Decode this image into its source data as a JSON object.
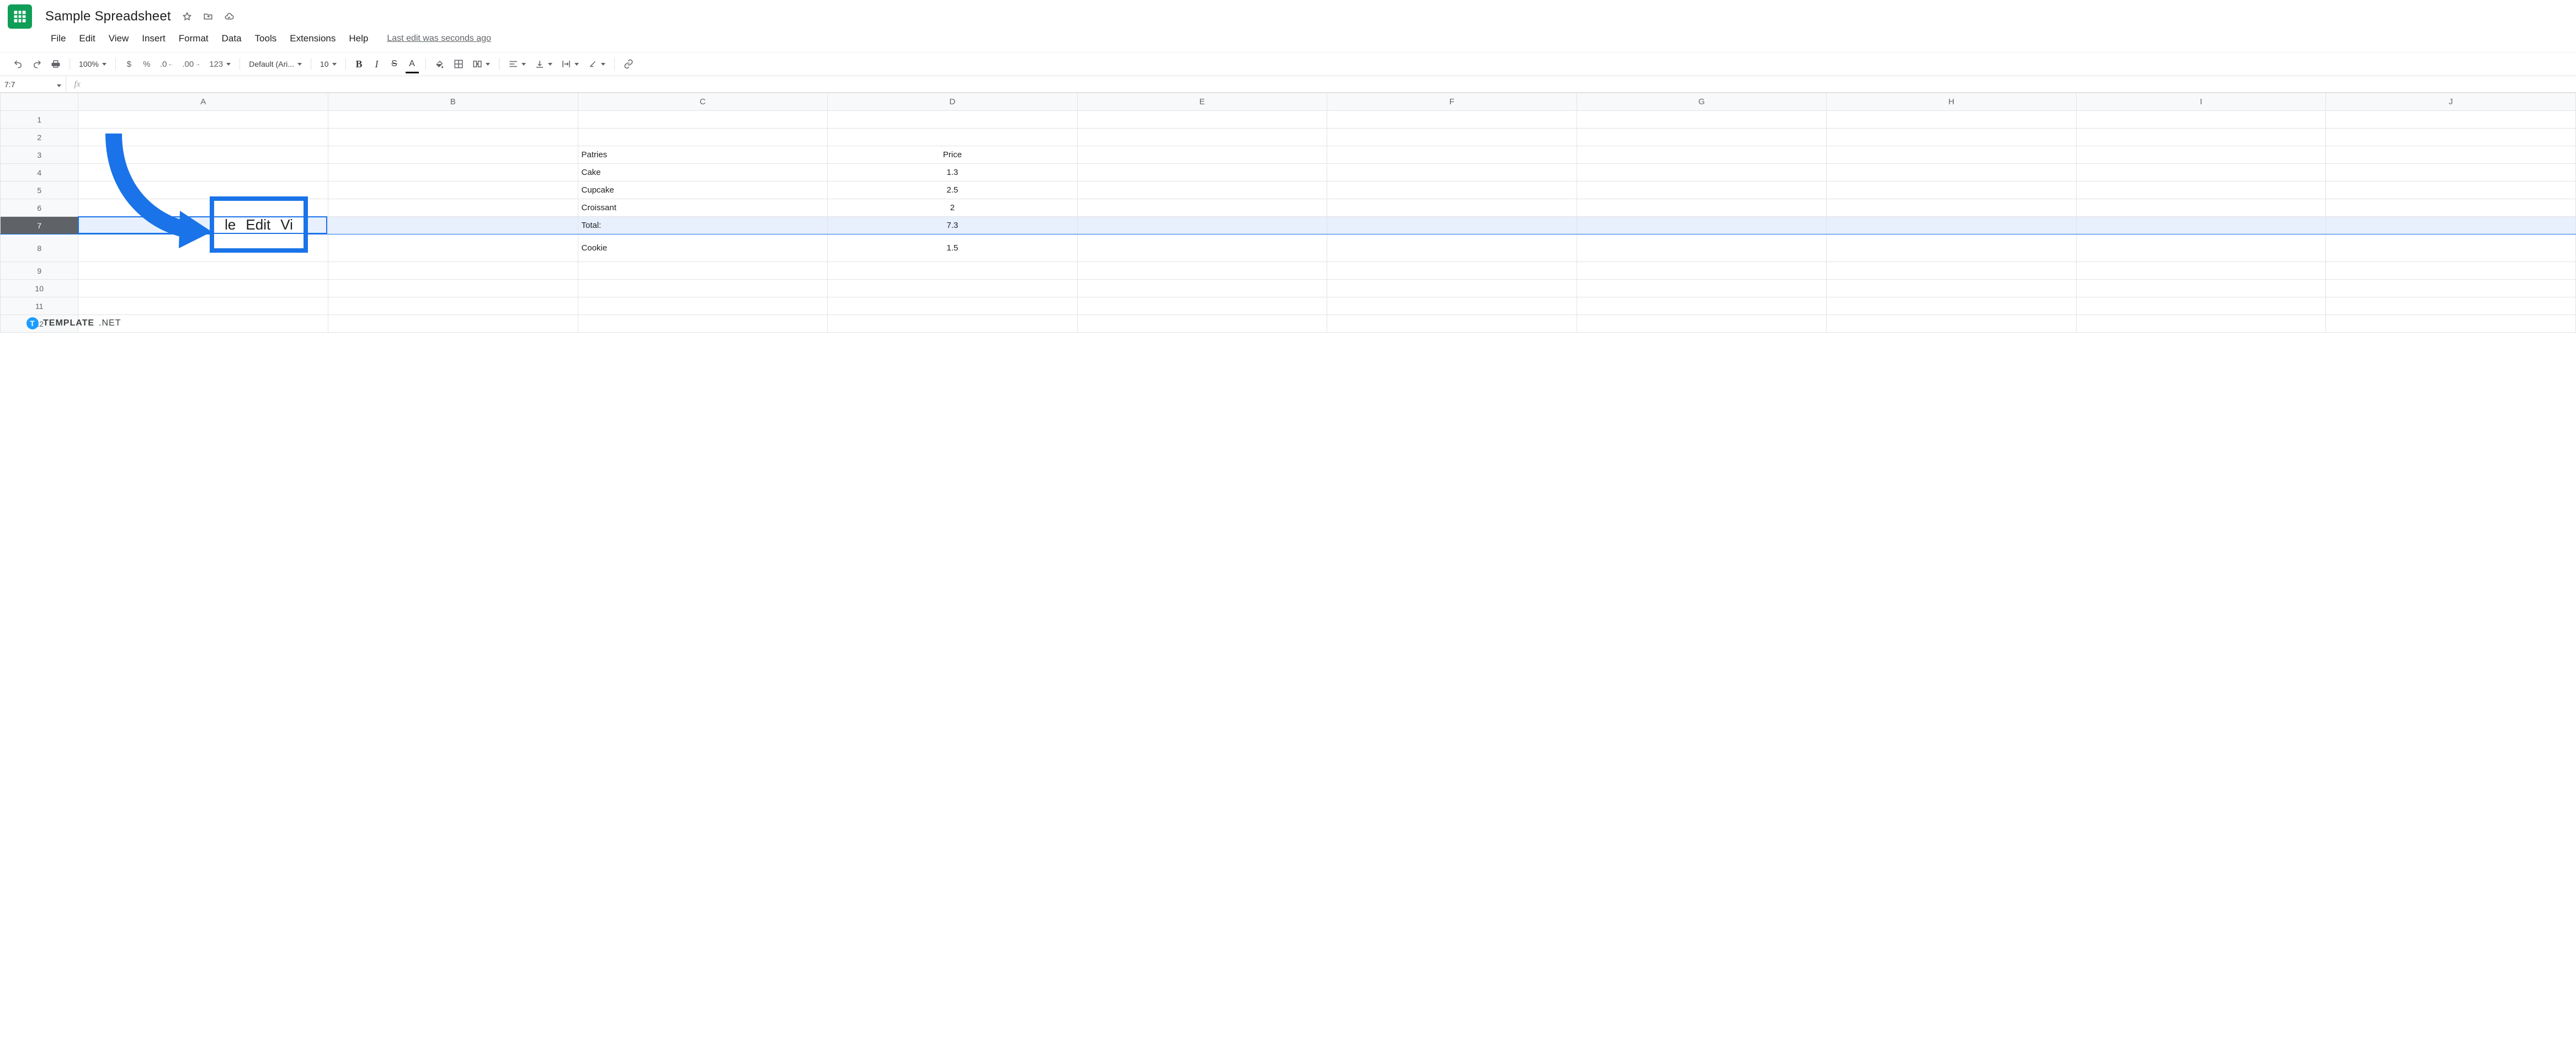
{
  "doc": {
    "title": "Sample Spreadsheet"
  },
  "menus": {
    "file": "File",
    "edit": "Edit",
    "view": "View",
    "insert": "Insert",
    "format": "Format",
    "data": "Data",
    "tools": "Tools",
    "extensions": "Extensions",
    "help": "Help",
    "last_edit": "Last edit was seconds ago"
  },
  "toolbar": {
    "zoom": "100%",
    "currency": "$",
    "percent": "%",
    "dec_dec": ".0",
    "inc_dec": ".00",
    "more_fmt": "123",
    "font": "Default (Ari...",
    "font_size": "10",
    "bold": "B",
    "italic": "I",
    "strike": "S",
    "text_color": "A"
  },
  "namebox": {
    "value": "7:7"
  },
  "columns": [
    "A",
    "B",
    "C",
    "D",
    "E",
    "F",
    "G",
    "H",
    "I",
    "J"
  ],
  "row_numbers": [
    "1",
    "2",
    "3",
    "4",
    "5",
    "6",
    "7",
    "8",
    "9",
    "10",
    "11",
    "12"
  ],
  "selected_row_index": 6,
  "tall_row_index": 7,
  "cells": {
    "C3": "Patries",
    "D3": "Price",
    "C4": "Cake",
    "D4": "1.3",
    "C5": "Cupcake",
    "D5": "2.5",
    "C6": "Croissant",
    "D6": "2",
    "C7": "Total:",
    "D7": "7.3",
    "C8": "Cookie",
    "D8": "1.5"
  },
  "callout": {
    "zoom_left": "le",
    "zoom_mid": "Edit",
    "zoom_right": "Vi"
  },
  "watermark": {
    "badge": "T",
    "brand": "TEMPLATE",
    "suffix": ".NET"
  }
}
